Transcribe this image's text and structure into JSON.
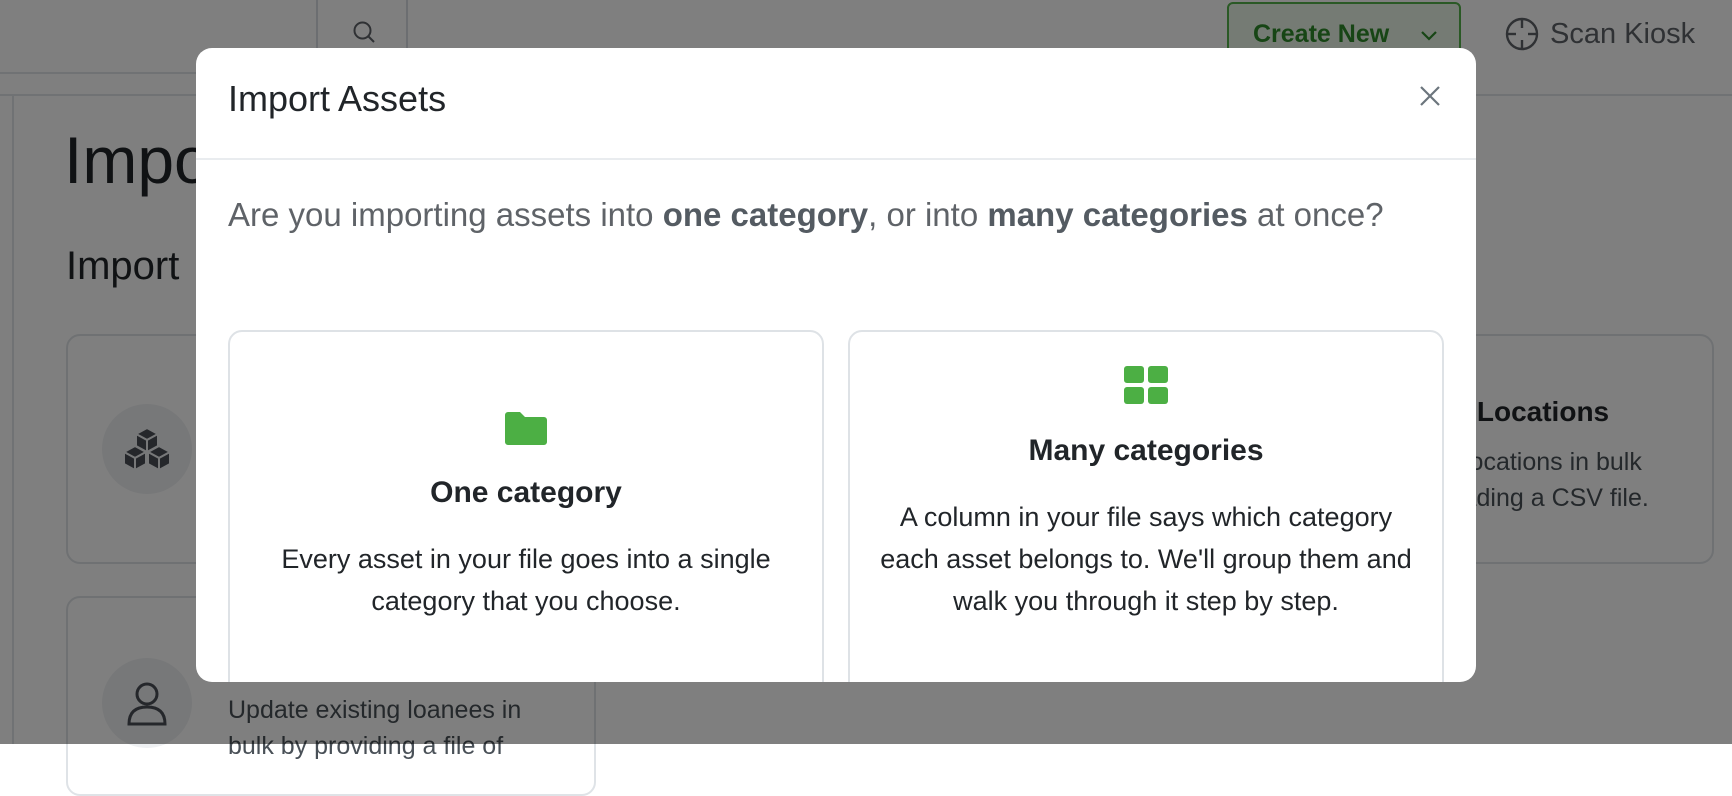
{
  "topbar": {
    "search_icon": "search-icon",
    "create_new_label": "Create New",
    "scan_kiosk_label": "Scan Kiosk",
    "accent_color": "#55b24a"
  },
  "page": {
    "title": "Imports",
    "section_title": "Import",
    "cards": [
      {
        "icon": "cubes-icon"
      },
      {
        "title": "Import Locations",
        "description_lines": [
          "Create locations in bulk",
          "by uploading a CSV file."
        ]
      },
      {
        "icon": "user-icon",
        "description_lines": [
          "Update existing loanees in",
          "bulk by providing a file of"
        ]
      }
    ]
  },
  "modal": {
    "title": "Import Assets",
    "close_icon": "close-icon",
    "question": {
      "part1": "Are you importing assets into ",
      "bold1": "one category",
      "part2": ", or into ",
      "bold2": "many categories",
      "part3": " at once?"
    },
    "options": [
      {
        "icon": "folder-icon",
        "title": "One category",
        "description": "Every asset in your file goes into a single category that you choose."
      },
      {
        "icon": "grid-icon",
        "title": "Many categories",
        "description": "A column in your file says which category each asset belongs to. We'll group them and walk you through it step by step."
      }
    ],
    "icon_color": "#4caf44"
  }
}
